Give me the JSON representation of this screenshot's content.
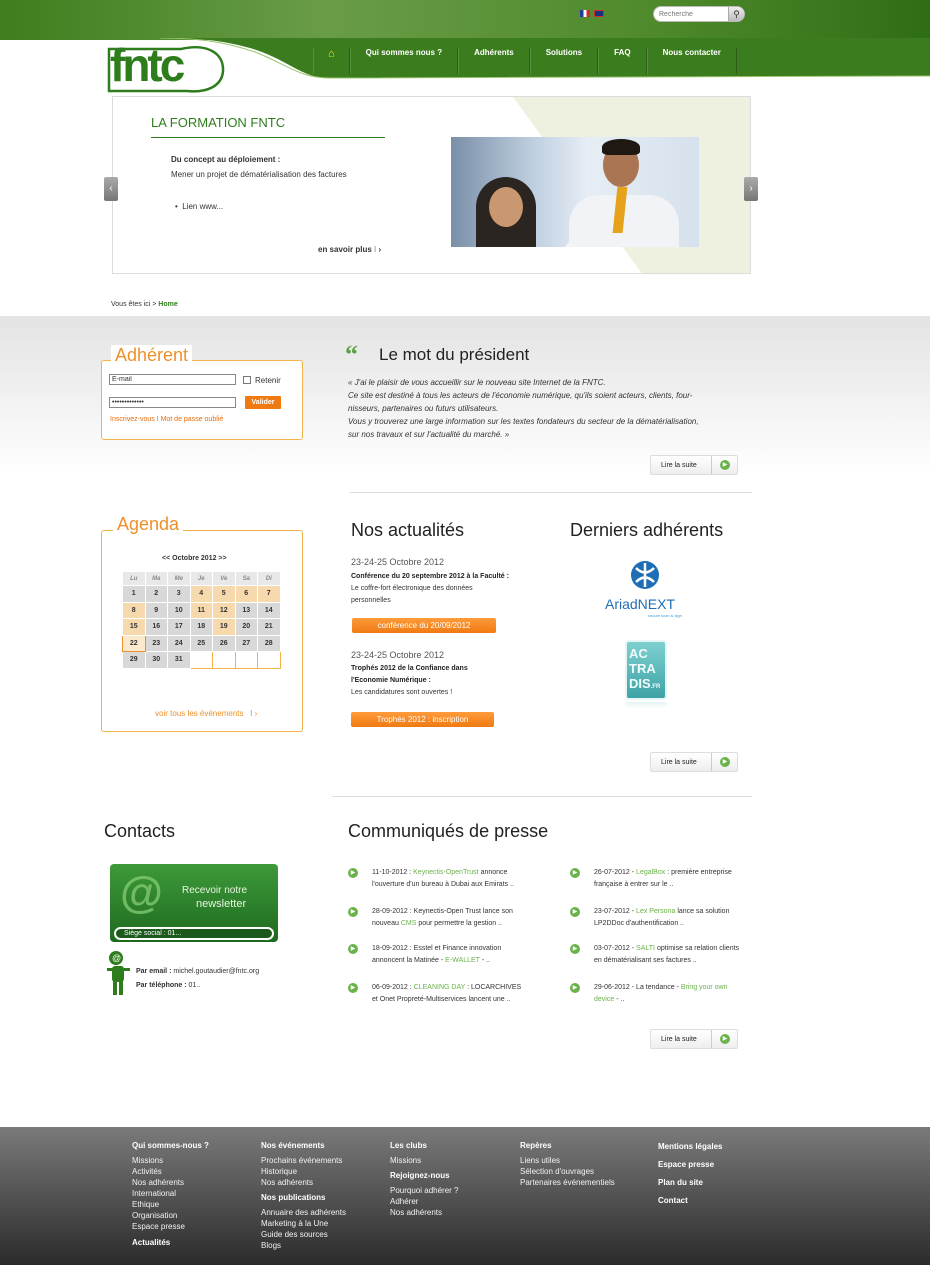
{
  "header": {
    "search_placeholder": "Recherche",
    "nav": [
      "Qui sommes nous ?",
      "Adhérents",
      "Solutions",
      "FAQ",
      "Nous contacter"
    ],
    "logo_text": "fntc"
  },
  "slider": {
    "title": "LA FORMATION FNTC",
    "subtitle": "Du concept au déploiement :",
    "description": "Mener un projet de dématérialisation des factures",
    "link": "Lien www...",
    "more": "en savoir plus"
  },
  "breadcrumb": {
    "prefix": "Vous êtes ici >",
    "home": "Home"
  },
  "adherent": {
    "title": "Adhérent",
    "email_value": "E-mail",
    "password_value": "•••••••••••••",
    "remember": "Retenir",
    "validate": "Valider",
    "links": "Inscrivez-vous I Mot de passe oublié"
  },
  "president": {
    "title": "Le mot du président",
    "lines": [
      "« J'ai le plaisir de vous accueillir sur le nouveau site Internet de la FNTC.",
      "Ce site est destiné à tous les acteurs de l'économie numérique, qu'ils soient acteurs, clients,  four-",
      "nisseurs, partenaires ou futurs utilisateurs.",
      "Vous y trouverez une large information sur les textes fondateurs du secteur de la dématérialisation,",
      "sur nos travaux et sur l'actualité du marché. »"
    ],
    "read_more": "Lire la suite"
  },
  "agenda": {
    "title": "Agenda",
    "month": "<<  Octobre 2012  >>",
    "days": [
      "Lu",
      "Ma",
      "Me",
      "Je",
      "Ve",
      "Sa",
      "Di"
    ],
    "weeks": [
      [
        "1",
        "2",
        "3",
        "4",
        "5",
        "6",
        "7"
      ],
      [
        "8",
        "9",
        "10",
        "11",
        "12",
        "13",
        "14"
      ],
      [
        "15",
        "16",
        "17",
        "18",
        "19",
        "20",
        "21"
      ],
      [
        "22",
        "23",
        "24",
        "25",
        "26",
        "27",
        "28"
      ],
      [
        "29",
        "30",
        "31",
        "",
        "",
        "",
        ""
      ]
    ],
    "link": "voir tous les événements"
  },
  "news": {
    "title": "Nos actualités",
    "items": [
      {
        "date": "23-24-25 Octobre 2012",
        "title": "Conférence du 20 septembre 2012 à la Faculté :",
        "text": "Le coffre-fort électronique des données personnelles",
        "button": "conférence du 20/09/2012"
      },
      {
        "date": "23-24-25 Octobre 2012",
        "title": "Trophés 2012 de la Confiance dans l'Economie Numérique :",
        "text": "Les candidatures sont ouvertes !",
        "button": "Trophés 2012 : inscription"
      }
    ]
  },
  "members": {
    "title": "Derniers adhérents",
    "ariadnext": "AriadNEXT",
    "ariadnext_tagline": "secure scan & sign",
    "actradis": [
      "AC",
      "TRA",
      "DIS"
    ],
    "actradis_tld": ".FR",
    "read_more": "Lire la suite"
  },
  "contacts": {
    "title": "Contacts",
    "newsletter_line1": "Recevoir notre",
    "newsletter_line2": "newsletter",
    "siege": "Siège social : 01...",
    "email_label": "Par email :",
    "email_value": "michel.goutaudier@fntc.org",
    "phone_label": "Par téléphone :",
    "phone_value": "01.."
  },
  "press": {
    "title": "Communiqués de presse",
    "left": [
      {
        "date": "11-10-2012 :",
        "org": "Keynectis-OpenTrust",
        "t1": "annonce",
        "t2": "l'ouverture d'un bureau à Dubai aux Emirats .."
      },
      {
        "date": "28-09-2012 :",
        "org": "",
        "t1": "Keynectis-Open Trust lance son",
        "t2": "nouveau",
        "org2": "CMS",
        "t3": "pour permettre la gestion .."
      },
      {
        "date": "18-09-2012 :",
        "org": "",
        "t1": "Esstel et Finance innovation",
        "t2": "annoncent la Matinée -",
        "org2": "E-WALLET",
        "t3": "- .."
      },
      {
        "date": "06-09-2012 :",
        "org": "CLEANING DAY",
        "t1": ": LOCARCHIVES",
        "t2": "et Onet Propreté-Multiservices lancent une .."
      }
    ],
    "right": [
      {
        "date": "26-07-2012 -",
        "org": "LegalBox",
        "t1": ": première entreprise",
        "t2": "française à entrer sur le .."
      },
      {
        "date": "23-07-2012 -",
        "org": "Lex Persona",
        "t1": "lance sa solution",
        "t2": "LP2DDoc d'authentification .."
      },
      {
        "date": "03-07-2012 -",
        "org": "SALTI",
        "t1": "optimise sa relation clients",
        "t2": "en dématérialisant ses factures .."
      },
      {
        "date": "29-06-2012 -",
        "org": "",
        "t1": "La tendance -",
        "org2": "Bring your own",
        "t2": "device",
        "t3": "- .."
      }
    ],
    "read_more": "Lire la suite"
  },
  "footer": {
    "col1": {
      "h": "Qui sommes-nous ?",
      "items": [
        "Missions",
        "Activités",
        "Nos adhérents",
        "International",
        "Ethique",
        "Organisation",
        "Espace presse"
      ],
      "h2": "Actualités"
    },
    "col2": {
      "h": "Nos événements",
      "items": [
        "Prochains événements",
        "Historique",
        "Nos adhérents"
      ],
      "h2": "Nos publications",
      "items2": [
        "Annuaire des adhérents",
        "Marketing à la Une",
        "Guide des sources",
        "Blogs"
      ]
    },
    "col3": {
      "h": "Les clubs",
      "items": [
        "Missions"
      ],
      "h2": "Rejoignez-nous",
      "items2": [
        "Pourquoi adhérer ?",
        "Adhérer",
        "Nos adhérents"
      ]
    },
    "col4": {
      "h": "Repères",
      "items": [
        "Liens utiles",
        "Sélection d'ouvrages",
        "Partenaires événementiels"
      ]
    },
    "col5": {
      "items": [
        "Mentions légales",
        "Espace presse",
        "Plan du site",
        "Contact"
      ]
    }
  },
  "colors": {
    "brand_green": "#2e7d1d",
    "accent_orange": "#f07a12",
    "bullet_green": "#6ab24a"
  }
}
